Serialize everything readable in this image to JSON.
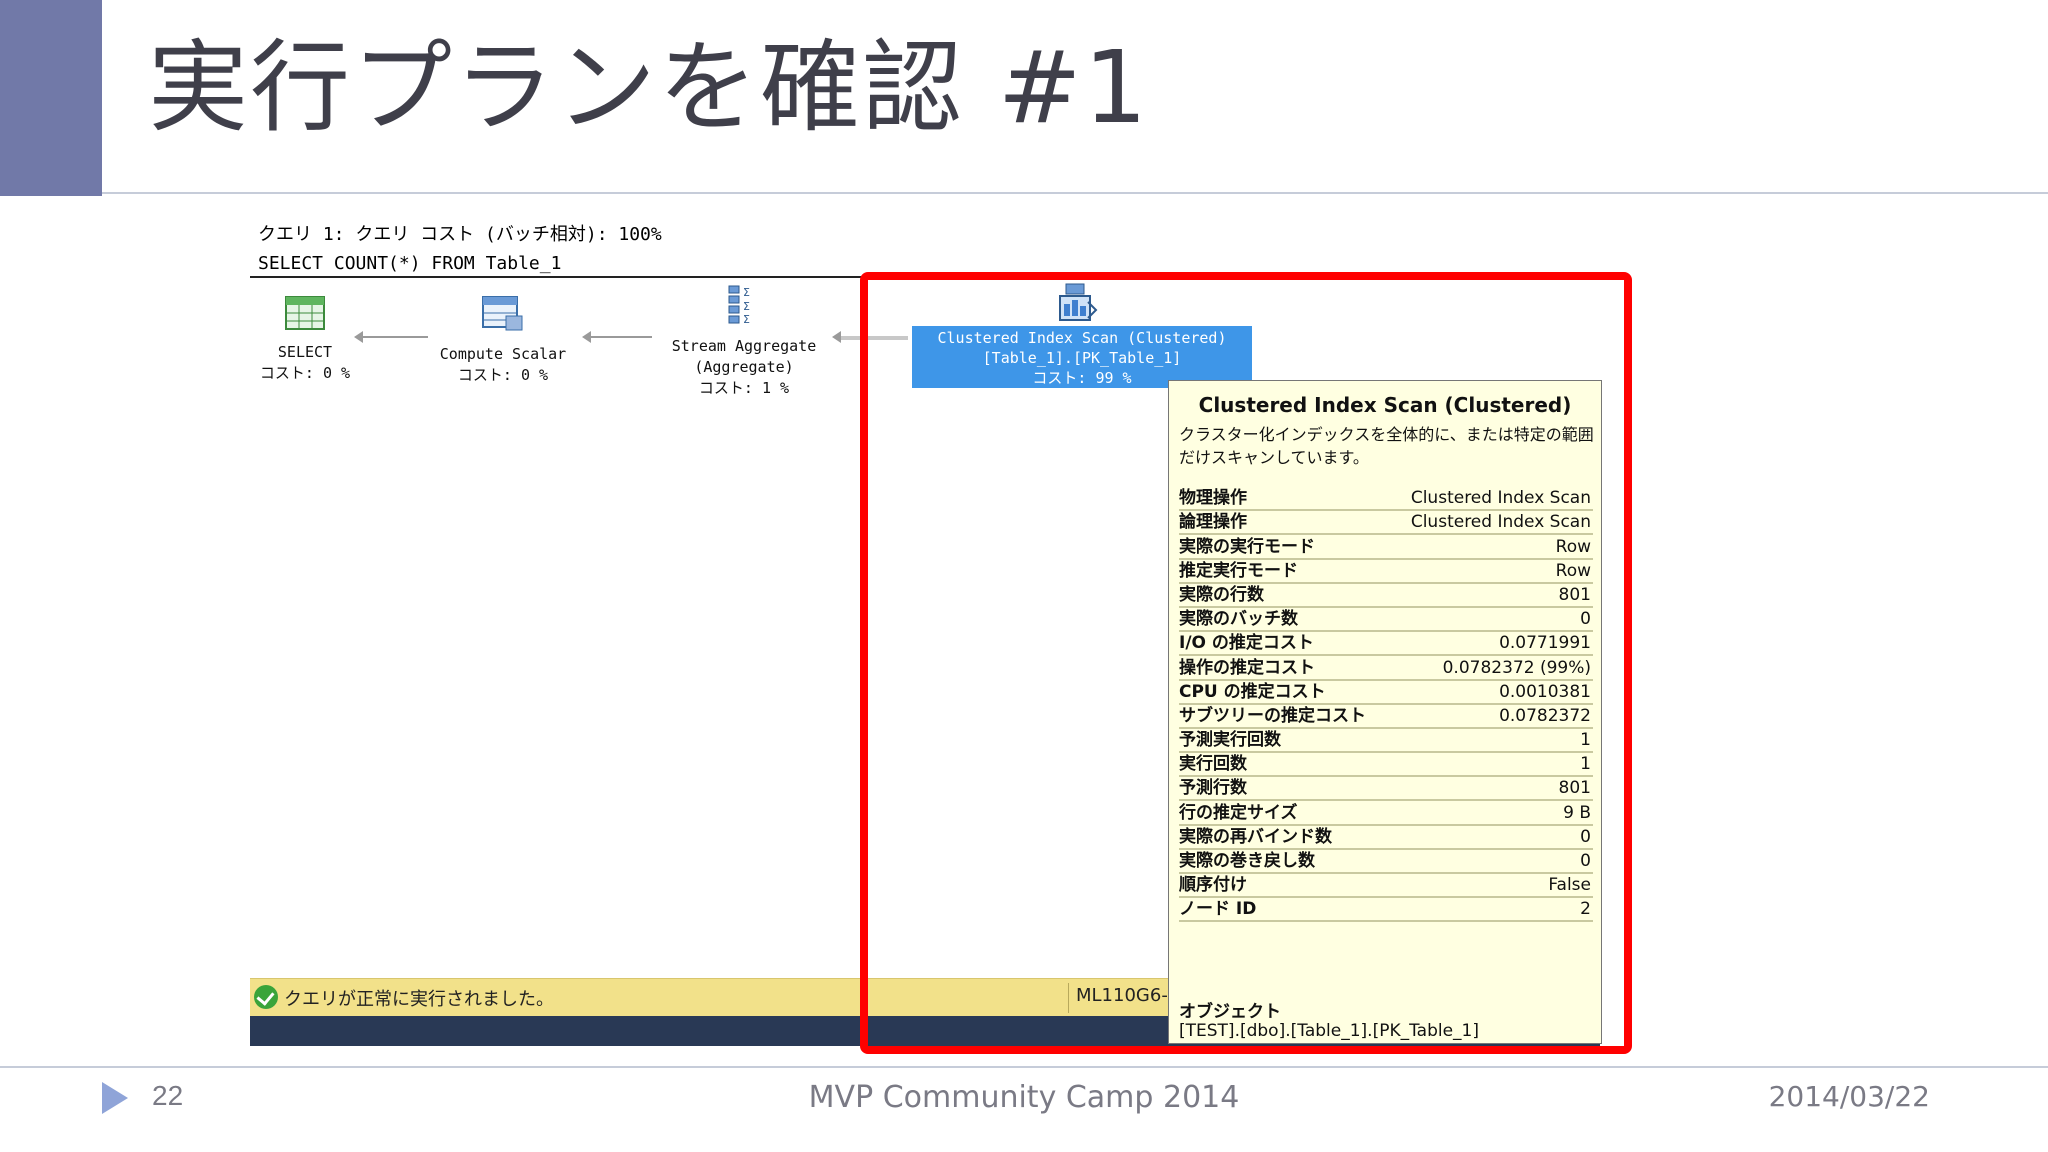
{
  "slide": {
    "title": "実行プランを確認 #1",
    "page_number": "22",
    "footer_center": "MVP Community Camp 2014",
    "date": "2014/03/22"
  },
  "plan": {
    "header_line1": "クエリ 1: クエリ コスト (バッチ相対): 100%",
    "header_line2": "SELECT COUNT(*) FROM Table_1",
    "operators": [
      {
        "line1": "SELECT",
        "line2": "コスト: 0 %",
        "icon": "select-table-icon"
      },
      {
        "line1": "Compute Scalar",
        "line2": "コスト: 0 %",
        "icon": "compute-scalar-icon"
      },
      {
        "line1": "Stream Aggregate",
        "line2": "(Aggregate)",
        "line3": "コスト: 1 %",
        "icon": "stream-aggregate-icon"
      },
      {
        "line1": "Clustered Index Scan (Clustered)",
        "line2": "[Table_1].[PK_Table_1]",
        "line3": "コスト: 99 %",
        "icon": "clustered-index-scan-icon"
      }
    ]
  },
  "tooltip": {
    "title": "Clustered Index Scan (Clustered)",
    "description": "クラスター化インデックスを全体的に、または特定の範囲だけスキャンしています。",
    "rows": [
      {
        "k": "物理操作",
        "v": "Clustered Index Scan"
      },
      {
        "k": "論理操作",
        "v": "Clustered Index Scan"
      },
      {
        "k": "実際の実行モード",
        "v": "Row"
      },
      {
        "k": "推定実行モード",
        "v": "Row"
      },
      {
        "k": "実際の行数",
        "v": "801"
      },
      {
        "k": "実際のバッチ数",
        "v": "0"
      },
      {
        "k": "I/O の推定コスト",
        "v": "0.0771991"
      },
      {
        "k": "操作の推定コスト",
        "v": "0.0782372 (99%)"
      },
      {
        "k": "CPU の推定コスト",
        "v": "0.0010381"
      },
      {
        "k": "サブツリーの推定コスト",
        "v": "0.0782372"
      },
      {
        "k": "予測実行回数",
        "v": "1"
      },
      {
        "k": "実行回数",
        "v": "1"
      },
      {
        "k": "予測行数",
        "v": "801"
      },
      {
        "k": "行の推定サイズ",
        "v": "9 B"
      },
      {
        "k": "実際の再バインド数",
        "v": "0"
      },
      {
        "k": "実際の巻き戻し数",
        "v": "0"
      },
      {
        "k": "順序付け",
        "v": "False"
      },
      {
        "k": "ノード ID",
        "v": "2"
      }
    ],
    "object_label": "オブジェクト",
    "object_value": "[TEST].[dbo].[Table_1].[PK_Table_1]"
  },
  "status": {
    "message": "クエリが正常に実行されました。",
    "server": "ML110G6-"
  },
  "colors": {
    "accent": "#7179a8",
    "highlight": "#ff0000",
    "selected_operator": "#3e96e8",
    "tooltip_bg": "#ffffe1",
    "status_bar": "#f2e18a"
  }
}
